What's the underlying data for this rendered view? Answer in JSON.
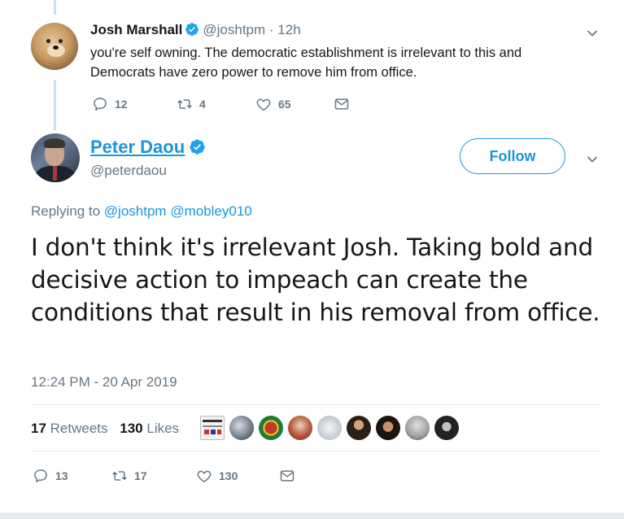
{
  "reply_tweet": {
    "name": "Josh Marshall",
    "handle": "@joshtpm",
    "time": "· 12h",
    "text": "you're self owning. The democratic establishment is irrelevant to this and Democrats have zero power to remove him from office.",
    "replies": "12",
    "retweets": "4",
    "likes": "65"
  },
  "main_tweet": {
    "name": "Peter Daou",
    "handle": "@peterdaou",
    "follow_label": "Follow",
    "replying_prefix": "Replying to",
    "replying_to_1": "@joshtpm",
    "replying_to_2": "@mobley010",
    "text": "I don't think it's irrelevant Josh. Taking bold and decisive action to impeach can create the conditions that result in his removal from office.",
    "timestamp": "12:24 PM - 20 Apr 2019",
    "retweet_count": "17",
    "retweet_label": "Retweets",
    "like_count": "130",
    "like_label": "Likes",
    "replies": "13",
    "retweets": "17",
    "likes": "130"
  },
  "icons": {
    "reply": "reply-icon",
    "retweet": "retweet-icon",
    "like": "heart-icon",
    "dm": "envelope-icon",
    "verified": "verified-badge-icon",
    "more": "chevron-down-icon"
  },
  "colors": {
    "accent": "#1b95e0",
    "secondary_text": "#657786",
    "thread_line": "#c4e0f5",
    "divider": "#e6ecf0"
  }
}
